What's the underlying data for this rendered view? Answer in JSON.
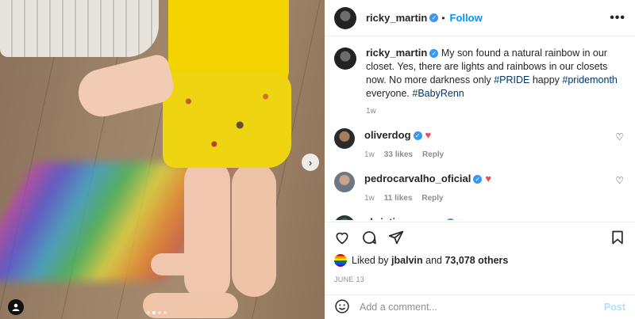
{
  "post": {
    "author": "ricky_martin",
    "follow_label": "Follow",
    "more_label": "•••",
    "caption": {
      "author": "ricky_martin",
      "text_before": "My son found a natural rainbow in our closet. Yes, there are lights and rainbows in our closets now. No more darkness only",
      "tag1": "#PRIDE",
      "mid": "happy",
      "tag2": "#pridemonth",
      "after": "everyone.",
      "tag3": "#BabyRenn",
      "time": "1w"
    },
    "comments": [
      {
        "user": "oliverdog",
        "time": "1w",
        "likes": "33 likes",
        "reply": "Reply"
      },
      {
        "user": "pedrocarvalho_oficial",
        "time": "1w",
        "likes": "11 likes",
        "reply": "Reply"
      },
      {
        "user": "christian_pagan"
      }
    ],
    "likes": {
      "prefix": "Liked by",
      "user": "jbalvin",
      "and": "and",
      "count": "73,078 others"
    },
    "date": "JUNE 13",
    "add_comment_placeholder": "Add a comment...",
    "post_label": "Post"
  },
  "icons": [
    "verified-badge",
    "heart-icon",
    "comment-icon",
    "share-icon",
    "save-icon",
    "emoji-icon",
    "chevron-right-icon",
    "tag-user-icon"
  ],
  "colors": {
    "link": "#0095f6",
    "hashtag": "#00376b",
    "heart": "#ed4956",
    "muted": "#8e8e8e"
  },
  "carousel": {
    "slides": 4,
    "active_index": 1
  }
}
